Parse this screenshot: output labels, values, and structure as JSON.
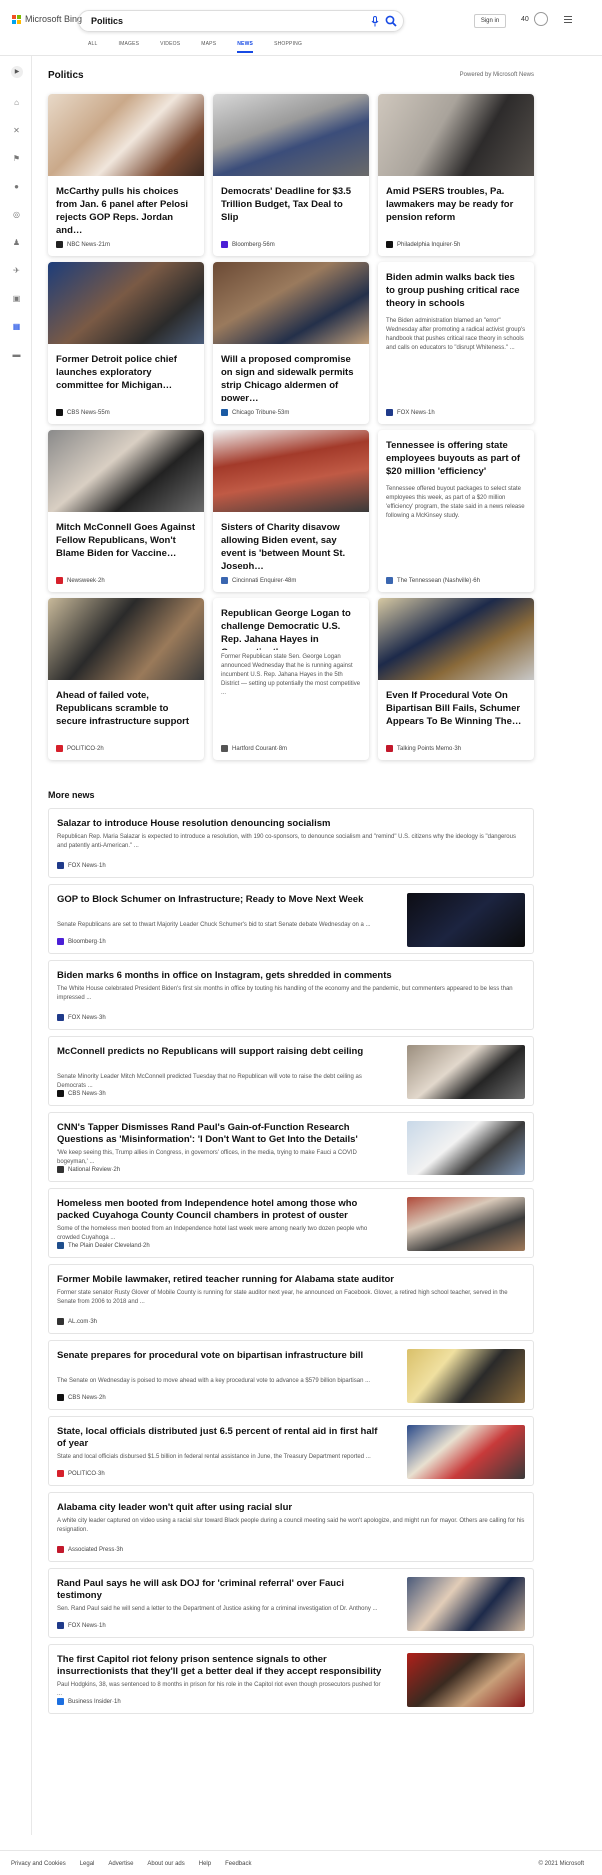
{
  "header": {
    "logo_text": "Microsoft Bing",
    "query": "Politics",
    "signin_label": "Sign in",
    "points": "40",
    "tabs": [
      "ALL",
      "IMAGES",
      "VIDEOS",
      "MAPS",
      "NEWS",
      "SHOPPING"
    ],
    "active_tab": "NEWS"
  },
  "section": {
    "title": "Politics",
    "powered": "Powered by Microsoft News"
  },
  "cards": [
    {
      "title": "McCarthy pulls his choices from Jan. 6 panel after Pelosi rejects GOP Reps. Jordan and…",
      "source": "NBC News",
      "time": "21m",
      "fav": "#222",
      "img": "pelosi"
    },
    {
      "title": "Democrats' Deadline for $3.5 Trillion Budget, Tax Deal to Slip",
      "source": "Bloomberg",
      "time": "56m",
      "fav": "#4b1fd6",
      "img": "sanders"
    },
    {
      "title": "Amid PSERS troubles, Pa. lawmakers may be ready for pension reform",
      "source": "Philadelphia Inquirer",
      "time": "5h",
      "fav": "#111",
      "img": "psers"
    },
    {
      "title": "Former Detroit police chief launches exploratory committee for Michigan…",
      "source": "CBS News",
      "time": "55m",
      "fav": "#111",
      "img": "craig"
    },
    {
      "title": "Will a proposed compromise on sign and sidewalk permits strip Chicago aldermen of power…",
      "source": "Chicago Tribune",
      "time": "53m",
      "fav": "#1b5aa3",
      "img": "council"
    },
    {
      "title": "Biden admin walks back ties to group pushing critical race theory in schools",
      "snippet": "The Biden administration blamed an \"error\" Wednesday after promoting a radical activist group's handbook that pushes critical race theory in schools and calls on educators to \"disrupt Whiteness.\" ...",
      "source": "FOX News",
      "time": "1h",
      "fav": "#1f3a8a",
      "img": ""
    },
    {
      "title": "Mitch McConnell Goes Against Fellow Republicans, Won't Blame Biden for Vaccine…",
      "source": "Newsweek",
      "time": "2h",
      "fav": "#d6202b",
      "img": "mcconnell"
    },
    {
      "title": "Sisters of Charity disavow allowing Biden event, say event is 'between Mount St. Joseph…",
      "source": "Cincinnati Enquirer",
      "time": "48m",
      "fav": "#3a66b0",
      "img": "building"
    },
    {
      "title": "Tennessee is offering state employees buyouts as part of $20 million 'efficiency' program",
      "snippet": "Tennessee offered buyout packages to select state employees this week, as part of a $20 million 'efficiency' program, the state said in a news release following a McKinsey study.",
      "source": "The Tennessean (Nashville)",
      "time": "6h",
      "fav": "#3a66b0",
      "img": ""
    },
    {
      "title": "Ahead of failed vote, Republicans scramble to secure infrastructure support",
      "source": "POLITICO",
      "time": "2h",
      "fav": "#d6202b",
      "img": "politico"
    },
    {
      "title": "Republican George Logan to challenge Democratic U.S. Rep. Jahana Hayes in Connecticut'…",
      "snippet": "Former Republican state Sen. George Logan announced Wednesday that he is running against incumbent U.S. Rep. Jahana Hayes in the 5th District — setting up potentially the most competitive ...",
      "source": "Hartford Courant",
      "time": "8m",
      "fav": "#555",
      "img": ""
    },
    {
      "title": "Even If Procedural Vote On Bipartisan Bill Fails, Schumer Appears To Be Winning The…",
      "source": "Talking Points Memo",
      "time": "3h",
      "fav": "#c2182b",
      "img": "schumer"
    }
  ],
  "more": {
    "title": "More news",
    "items": [
      {
        "title": "Salazar to introduce House resolution denouncing socialism",
        "snippet": "Republican Rep. Maria Salazar is expected to introduce a resolution, with 190 co-sponsors, to denounce socialism and \"remind\" U.S. citizens why the ideology is \"dangerous and patently anti-American.\" ...",
        "source": "FOX News",
        "time": "1h",
        "fav": "#1f3a8a",
        "thumb": ""
      },
      {
        "title": "GOP to Block Schumer on Infrastructure; Ready to Move Next Week",
        "snippet": "Senate Republicans are set to thwart Majority Leader Chuck Schumer's bid to start Senate debate Wednesday on a ...",
        "source": "Bloomberg",
        "time": "1h",
        "fav": "#4b1fd6",
        "thumb": "dark"
      },
      {
        "title": "Biden marks 6 months in office on Instagram, gets shredded in comments",
        "snippet": "The White House celebrated President Biden's first six months in office by touting his handling of the economy and the pandemic, but commenters appeared to be less than impressed ...",
        "source": "FOX News",
        "time": "3h",
        "fav": "#1f3a8a",
        "thumb": ""
      },
      {
        "title": "McConnell predicts no Republicans will support raising debt ceiling",
        "snippet": "Senate Minority Leader Mitch McConnell predicted Tuesday that no Republican will vote to raise the debt ceiling as Democrats ...",
        "source": "CBS News",
        "time": "3h",
        "fav": "#111",
        "thumb": "mcc2"
      },
      {
        "title": "CNN's Tapper Dismisses Rand Paul's Gain-of-Function Research Questions as 'Misinformation': 'I Don't Want to Get Into the Details'",
        "snippet": "'We keep seeing this, Trump allies in Congress, in governors' offices, in the media, trying to make Fauci a COVID bogeyman,' ...",
        "source": "National Review",
        "time": "2h",
        "fav": "#333",
        "thumb": "tapper"
      },
      {
        "title": "Homeless men booted from Independence hotel among those who packed Cuyahoga County Council chambers in protest of ouster",
        "snippet": "Some of the homeless men booted from an Independence hotel last week were among nearly two dozen people who crowded Cuyahoga ...",
        "source": "The Plain Dealer Cleveland",
        "time": "2h",
        "fav": "#1f4e8c",
        "thumb": "crowd"
      },
      {
        "title": "Former Mobile lawmaker, retired teacher running for Alabama state auditor",
        "snippet": "Former state senator Rusty Glover of Mobile County is running for state auditor next year, he announced on Facebook. Glover, a retired high school teacher, served in the Senate from 2006 to 2018 and ...",
        "source": "AL.com",
        "time": "3h",
        "fav": "#333",
        "thumb": ""
      },
      {
        "title": "Senate prepares for procedural vote on bipartisan infrastructure bill",
        "snippet": "The Senate on Wednesday is poised to move ahead with a key procedural vote to advance a $579 billion bipartisan ...",
        "source": "CBS News",
        "time": "2h",
        "fav": "#111",
        "thumb": "schumer2"
      },
      {
        "title": "State, local officials distributed just 6.5 percent of rental aid in first half of year",
        "snippet": "State and local officials disbursed $1.5 billion in federal rental assistance in June, the Treasury Department reported ...",
        "source": "POLITICO",
        "time": "3h",
        "fav": "#d6202b",
        "thumb": "evict"
      },
      {
        "title": "Alabama city leader won't quit after using racial slur",
        "snippet": "A white city leader captured on video using a racial slur toward Black people during a council meeting said he won't apologize, and might run for mayor. Others are calling for his resignation.",
        "source": "Associated Press",
        "time": "3h",
        "fav": "#c2182b",
        "thumb": ""
      },
      {
        "title": "Rand Paul says he will ask DOJ for 'criminal referral' over Fauci testimony",
        "snippet": "Sen. Rand Paul said he will send a letter to the Department of Justice asking for a criminal investigation of Dr. Anthony ...",
        "source": "FOX News",
        "time": "1h",
        "fav": "#1f3a8a",
        "thumb": "fauci"
      },
      {
        "title": "The first Capitol riot felony prison sentence signals to other insurrectionists that they'll get a better deal if they accept responsibility",
        "snippet": "Paul Hodgkins, 38, was sentenced to 8 months in prison for his role in the Capitol riot even though prosecutors pushed for ...",
        "source": "Business Insider",
        "time": "1h",
        "fav": "#1c6fe0",
        "thumb": "riot"
      }
    ]
  },
  "footer": {
    "links": [
      "Privacy and Cookies",
      "Legal",
      "Advertise",
      "About our ads",
      "Help",
      "Feedback"
    ],
    "copyright": "© 2021 Microsoft"
  }
}
